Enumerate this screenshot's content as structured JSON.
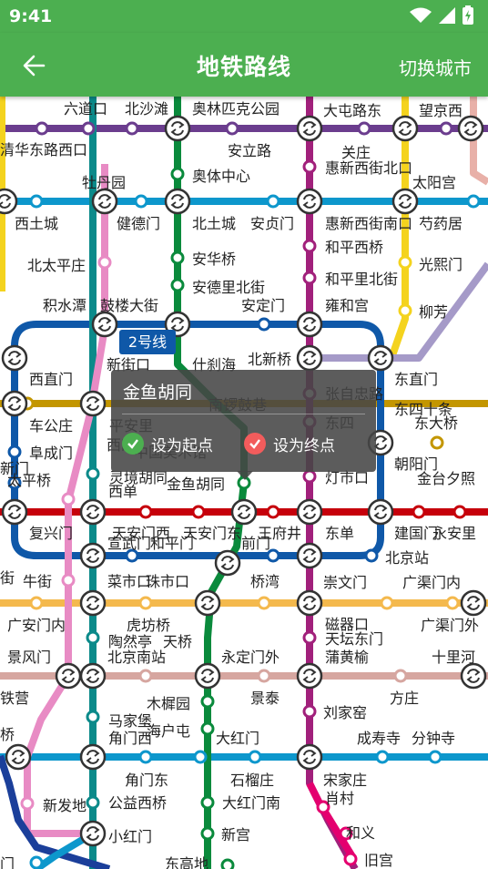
{
  "status": {
    "time": "9:41",
    "icons": [
      "wifi-icon",
      "signal-icon",
      "battery-icon"
    ]
  },
  "appbar": {
    "title": "地铁路线",
    "switch_city": "切换城市",
    "back_icon": "arrow-left-icon"
  },
  "colors": {
    "primary": "#4caf50",
    "line2": "#0f58a8",
    "line5": "#a1207b",
    "line6": "#c39600",
    "line8": "#0a8a3c",
    "line10": "#0d97cc",
    "line13": "#f4d31e",
    "line4": "#0b8a8a",
    "line1": "#c6000b",
    "line7": "#f4b94d"
  },
  "map": {
    "line_badge": "2号线",
    "labels": [
      "六道口",
      "北沙滩",
      "奥林匹克公园",
      "大屯路东",
      "望京西",
      "清华东路西口",
      "安立路",
      "关庄",
      "惠新西街北口",
      "太阳宫",
      "牡丹园",
      "奥体中心",
      "西土城",
      "健德门",
      "北土城",
      "安贞门",
      "惠新西街南口",
      "芍药居",
      "和平西桥",
      "北太平庄",
      "安华桥",
      "光熙门",
      "安德里北街",
      "和平里北街",
      "积水潭",
      "鼓楼大街",
      "安定门",
      "雍和宫",
      "柳芳",
      "新街口",
      "什刹海",
      "北新桥",
      "西直门",
      "东直门",
      "张自忠路",
      "东四十条",
      "车公庄",
      "平安里",
      "南锣鼓巷",
      "东四",
      "东大桥",
      "阜成门",
      "西四",
      "中国美术馆",
      "朝阳门",
      "太平桥",
      "灵境胡同",
      "金鱼胡同",
      "灯市口",
      "金台夕照",
      "西单",
      "复兴门",
      "天安门西",
      "天安门东",
      "王府井",
      "东单",
      "建国门",
      "永安里",
      "宣武门",
      "和平门",
      "前门",
      "北京站",
      "牛街",
      "菜市口",
      "珠市口",
      "桥湾",
      "崇文门",
      "广渠门内",
      "广安门内",
      "虎坊桥",
      "磁器口",
      "广渠门外",
      "陶然亭",
      "天桥",
      "天坛东门",
      "景风门",
      "北京南站",
      "永定门外",
      "蒲黄榆",
      "十里河",
      "铁营",
      "木樨园",
      "景泰",
      "方庄",
      "马家堡",
      "刘家窑",
      "角门西",
      "海户屯",
      "大红门",
      "成寿寺",
      "分钟寺",
      "角门东",
      "石榴庄",
      "宋家庄",
      "新发地",
      "公益西桥",
      "大红门南",
      "肖村",
      "新宫",
      "和义",
      "小红门",
      "东高地",
      "旧宫",
      "门",
      "桥",
      "街",
      "新门"
    ]
  },
  "popup": {
    "station": "金鱼胡同",
    "set_start": "设为起点",
    "set_end": "设为终点",
    "start_color": "#4caf50",
    "end_color": "#f25c5c"
  }
}
